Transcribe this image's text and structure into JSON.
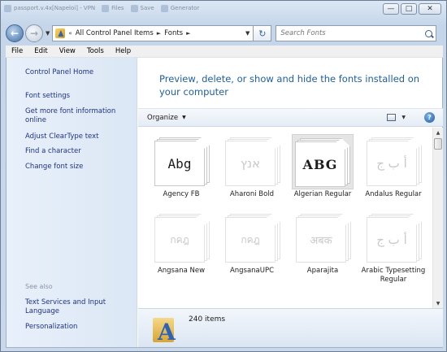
{
  "background_tasks": [
    {
      "label": "passport.v.4x[Napeloi] - VPN"
    },
    {
      "label": "Files"
    },
    {
      "label": "Save"
    },
    {
      "label": "Generator"
    }
  ],
  "window": {
    "minimize_glyph": "—",
    "maximize_glyph": "□",
    "close_glyph": "✕"
  },
  "address": {
    "back_glyph": "←",
    "forward_glyph": "→",
    "breadcrumb": [
      "All Control Panel Items",
      "Fonts"
    ],
    "prefix_glyph": "«",
    "sep_glyph": "►",
    "refresh_glyph": "↻",
    "dropdown_glyph": "▼"
  },
  "search": {
    "placeholder": "Search Fonts"
  },
  "menu": [
    "File",
    "Edit",
    "View",
    "Tools",
    "Help"
  ],
  "left_pane": {
    "home": "Control Panel Home",
    "links": [
      "Font settings",
      "Get more font information online",
      "Adjust ClearType text",
      "Find a character",
      "Change font size"
    ],
    "see_also_header": "See also",
    "see_also": [
      "Text Services and Input Language",
      "Personalization"
    ]
  },
  "header": {
    "title": "Preview, delete, or show and hide the fonts installed on your computer"
  },
  "toolbar": {
    "organize_label": "Organize",
    "organize_caret": "▼",
    "view_caret": "▼",
    "help_glyph": "?"
  },
  "fonts": [
    {
      "name": "Agency FB",
      "sample": "Abg",
      "state": "normal"
    },
    {
      "name": "Aharoni Bold",
      "sample": "אנץ",
      "state": "faded"
    },
    {
      "name": "Algerian Regular",
      "sample": "ABG",
      "state": "selected"
    },
    {
      "name": "Andalus Regular",
      "sample": "أ ب ج",
      "state": "faded"
    },
    {
      "name": "Angsana New",
      "sample": "กคฎ",
      "state": "faded"
    },
    {
      "name": "AngsanaUPC",
      "sample": "กคฎ",
      "state": "faded"
    },
    {
      "name": "Aparajita",
      "sample": "अबक",
      "state": "faded"
    },
    {
      "name": "Arabic Typesetting Regular",
      "sample": "أ ب ج",
      "state": "faded"
    }
  ],
  "details": {
    "count": "240 items",
    "glyph": "A"
  },
  "scrollbar": {
    "up_glyph": "▲",
    "down_glyph": "▼"
  }
}
